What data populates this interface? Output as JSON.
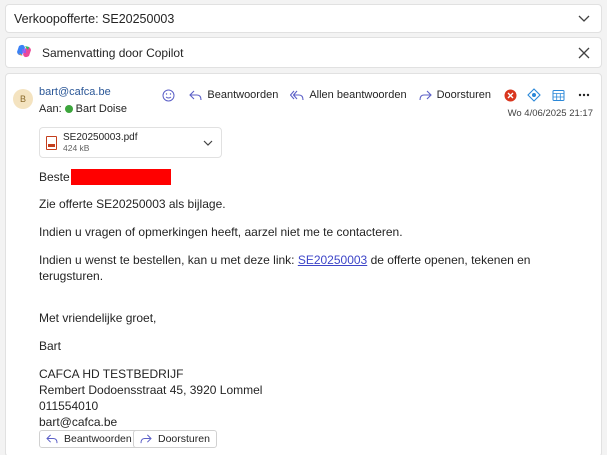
{
  "subject": "Verkoopofferte: SE20250003",
  "copilot": {
    "title": "Samenvatting door Copilot"
  },
  "sender": {
    "avatar_initial": "B",
    "email": "bart@cafca.be",
    "to_label": "Aan:",
    "to_name": "Bart Doise"
  },
  "actions": {
    "reply": "Beantwoorden",
    "reply_all": "Allen beantwoorden",
    "forward": "Doorsturen"
  },
  "date": "Wo 4/06/2025 21:17",
  "attachment": {
    "name": "SE20250003.pdf",
    "size": "424 kB"
  },
  "body": {
    "greeting": "Beste",
    "line1": "Zie offerte SE20250003 als bijlage.",
    "line2": "Indien u vragen of opmerkingen heeft, aarzel niet me te contacteren.",
    "line3_before": "Indien u wenst te bestellen, kan u met deze link: ",
    "line3_link": "SE20250003",
    "line3_after": " de offerte openen, tekenen en terugsturen.",
    "closing": "Met vriendelijke groet,",
    "name": "Bart",
    "company": "CAFCA HD TESTBEDRIJF",
    "address": "Rembert Dodoensstraat 45, 3920 Lommel",
    "phone": "011554010",
    "email": "bart@cafca.be"
  },
  "footer": {
    "reply": "Beantwoorden",
    "forward": "Doorsturen"
  },
  "colors": {
    "accent": "#5b5fc7",
    "link": "#3d45c8",
    "redaction": "#ff0000",
    "online": "#3ca53c"
  }
}
